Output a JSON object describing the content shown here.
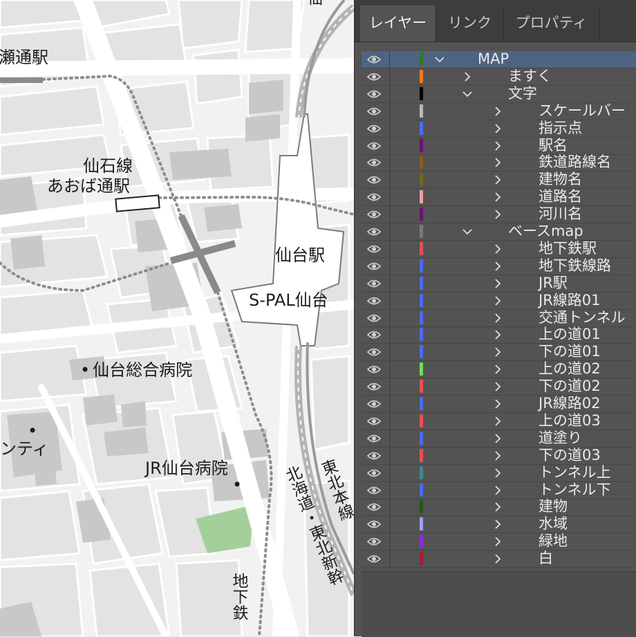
{
  "map": {
    "labels": {
      "hirose_station": "瀬通駅",
      "sensekisen_line": "仙石線",
      "aoba_station": "あおば通駅",
      "sendai_station": "仙台駅",
      "spal": "S-PAL仙台",
      "hospital_general": "仙台総合病院",
      "city": "ンティ",
      "jr_hospital": "JR仙台病院",
      "hokkaido_tohoku": "北海道・東北新幹",
      "tohoku_main": "東北本線",
      "subway": "地下鉄",
      "top_fragment": "仙"
    }
  },
  "panel": {
    "tabs": [
      {
        "label": "レイヤー",
        "active": true
      },
      {
        "label": "リンク",
        "active": false
      },
      {
        "label": "プロパティ",
        "active": false
      }
    ],
    "layers": [
      {
        "name": "MAP",
        "color": "#2e7a1f",
        "expanded": true,
        "selected": true
      },
      {
        "name": "ますく",
        "color": "#ee7a1e",
        "expanded": false
      },
      {
        "name": "文字",
        "color": "#000000",
        "expanded": true
      },
      {
        "name": "スケールバー",
        "color": "#b8b8b8",
        "expanded": false
      },
      {
        "name": "指示点",
        "color": "#4a6cf0",
        "expanded": false
      },
      {
        "name": "駅名",
        "color": "#6a1070",
        "expanded": false
      },
      {
        "name": "鉄道路線名",
        "color": "#8a5a1e",
        "expanded": false
      },
      {
        "name": "建物名",
        "color": "#6c6a14",
        "expanded": false
      },
      {
        "name": "道路名",
        "color": "#eda0a0",
        "expanded": false
      },
      {
        "name": "河川名",
        "color": "#6a1070",
        "expanded": false
      },
      {
        "name": "ベースmap",
        "color": "#7a7a7a",
        "expanded": true
      },
      {
        "name": "地下鉄駅",
        "color": "#e65050",
        "expanded": false
      },
      {
        "name": "地下鉄線路",
        "color": "#4a6cf0",
        "expanded": false
      },
      {
        "name": "JR駅",
        "color": "#4a6cf0",
        "expanded": false
      },
      {
        "name": "JR線路01",
        "color": "#4a6cf0",
        "expanded": false
      },
      {
        "name": "交通トンネル",
        "color": "#4a6cf0",
        "expanded": false
      },
      {
        "name": "上の道01",
        "color": "#4a6cf0",
        "expanded": false
      },
      {
        "name": "下の道01",
        "color": "#4a6cf0",
        "expanded": false
      },
      {
        "name": "上の道02",
        "color": "#6ee05a",
        "expanded": false
      },
      {
        "name": "下の道02",
        "color": "#e65050",
        "expanded": false
      },
      {
        "name": "JR線路02",
        "color": "#4a6cf0",
        "expanded": false
      },
      {
        "name": "上の道03",
        "color": "#e65050",
        "expanded": false
      },
      {
        "name": "道塗り",
        "color": "#4a6cf0",
        "expanded": false
      },
      {
        "name": "下の道03",
        "color": "#e65050",
        "expanded": false
      },
      {
        "name": "トンネル上",
        "color": "#3e8a92",
        "expanded": false
      },
      {
        "name": "トンネル下",
        "color": "#4a6cf0",
        "expanded": false
      },
      {
        "name": "建物",
        "color": "#1e5a14",
        "expanded": false
      },
      {
        "name": "水域",
        "color": "#a09ef0",
        "expanded": false
      },
      {
        "name": "緑地",
        "color": "#8a2ae0",
        "expanded": false
      },
      {
        "name": "白",
        "color": "#a0203a",
        "expanded": false
      }
    ]
  }
}
